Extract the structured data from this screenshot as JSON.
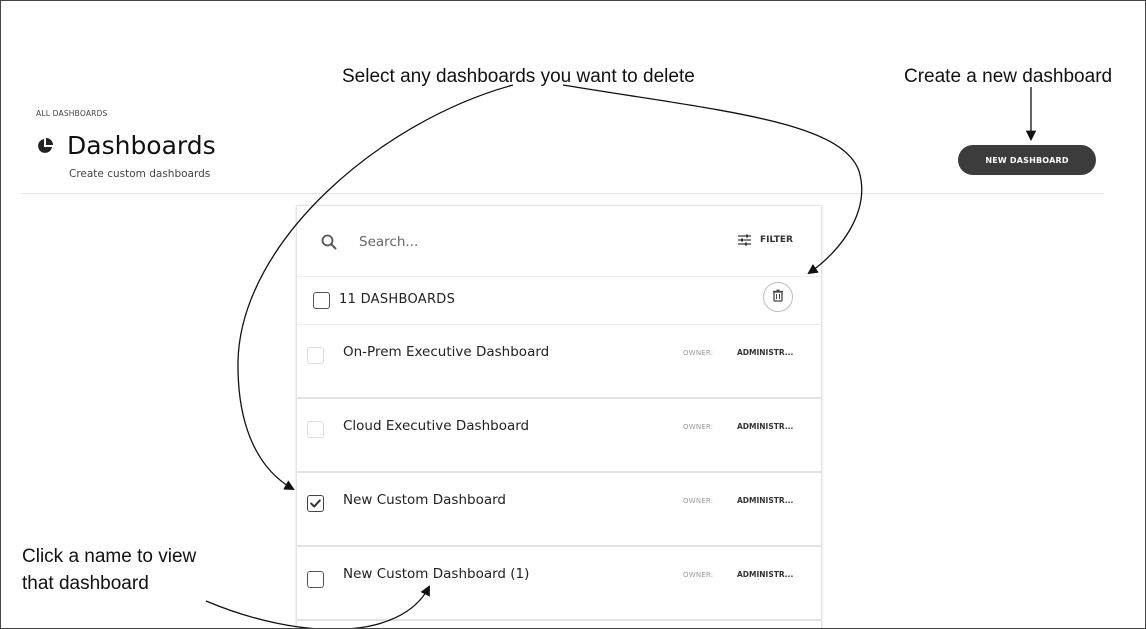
{
  "annotations": {
    "select_delete": "Select any dashboards you want to delete",
    "create_new": "Create a new dashboard",
    "click_name_line1": "Click a name to view",
    "click_name_line2": "that dashboard"
  },
  "header": {
    "breadcrumb": "ALL DASHBOARDS",
    "title": "Dashboards",
    "subtitle": "Create custom dashboards",
    "title_icon": "pie-chart-icon",
    "new_button_label": "NEW DASHBOARD"
  },
  "search": {
    "placeholder": "Search...",
    "value": "",
    "icon": "search-icon",
    "filter_label": "FILTER",
    "filter_icon": "sliders-icon"
  },
  "list": {
    "count_label": "11 DASHBOARDS",
    "delete_icon": "trash-icon",
    "owner_label": "OWNER:",
    "rows": [
      {
        "name": "On-Prem Executive Dashboard",
        "owner": "ADMINISTR...",
        "checked": false
      },
      {
        "name": "Cloud Executive Dashboard",
        "owner": "ADMINISTR...",
        "checked": false
      },
      {
        "name": "New Custom Dashboard",
        "owner": "ADMINISTR...",
        "checked": true
      },
      {
        "name": "New Custom Dashboard (1)",
        "owner": "ADMINISTR...",
        "checked": false
      }
    ]
  },
  "colors": {
    "button_bg": "#3c3c3c",
    "button_text": "#ffffff",
    "divider": "#e6e6e6"
  }
}
